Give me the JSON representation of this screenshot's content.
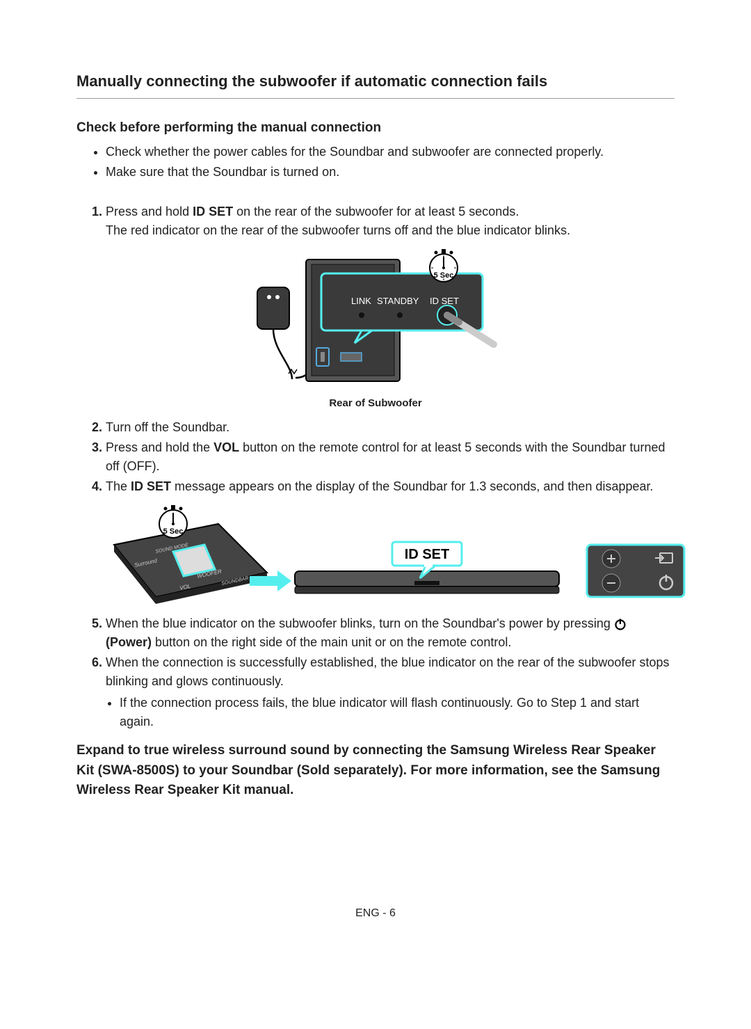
{
  "section_title": "Manually connecting the subwoofer if automatic connection fails",
  "check": {
    "heading": "Check before performing the manual connection",
    "bullets": [
      "Check whether the power cables for the Soundbar and subwoofer are connected properly.",
      "Make sure that the Soundbar is turned on."
    ]
  },
  "steps": {
    "s1_a": "Press and hold ",
    "s1_bold": "ID SET",
    "s1_b": " on the rear of the subwoofer for at least 5 seconds.",
    "s1_c": "The red indicator on the rear of the subwoofer turns off and the blue indicator blinks.",
    "fig1": {
      "caption": "Rear of Subwoofer",
      "timer": "5 Sec",
      "labels": {
        "link": "LINK",
        "standby": "STANDBY",
        "idset": "ID SET"
      }
    },
    "s2": "Turn off the Soundbar.",
    "s3_a": "Press and hold the ",
    "s3_bold": "VOL",
    "s3_b": " button on the remote control for at least 5 seconds with the Soundbar turned off (OFF).",
    "s4_a": "The ",
    "s4_bold": "ID SET",
    "s4_b": " message appears on the display of the Soundbar for 1.3 seconds, and then disappear.",
    "fig2": {
      "timer": "5 Sec",
      "callout": "ID SET",
      "remote": {
        "surround": "Surround",
        "soundmode": "SOUND MODE",
        "woofer": "WOOFER",
        "vol": "VOL",
        "soundbar": "SOUNDBAR"
      }
    },
    "s5_a": "When the blue indicator on the subwoofer blinks, turn on the Soundbar's power by pressing ",
    "s5_power_label": "(Power)",
    "s5_b": " button on the right side of the main unit or on the remote control.",
    "s6": "When the connection is successfully established, the blue indicator on the rear of the subwoofer stops blinking and glows continuously.",
    "s6_sub": "If the connection process fails, the blue indicator will flash continuously. Go to Step 1 and start again."
  },
  "closing": "Expand to true wireless surround sound by connecting the Samsung Wireless Rear Speaker Kit (SWA-8500S) to your Soundbar (Sold separately). For more information, see the Samsung Wireless Rear Speaker Kit manual.",
  "footer": "ENG - 6"
}
